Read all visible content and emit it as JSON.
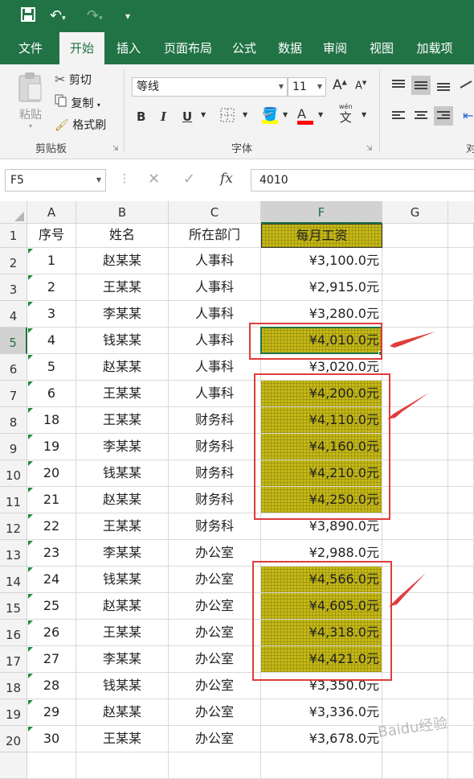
{
  "qat": {
    "save_icon": "floppy-disk-icon",
    "undo_icon": "undo-icon",
    "redo_icon": "redo-icon",
    "customize_icon": "customize-qat-icon"
  },
  "tabs": [
    "文件",
    "开始",
    "插入",
    "页面布局",
    "公式",
    "数据",
    "审阅",
    "视图",
    "加载项"
  ],
  "active_tab": "开始",
  "ribbon": {
    "clipboard": {
      "paste": "粘贴",
      "cut": "剪切",
      "copy": "复制",
      "format_painter": "格式刷",
      "label": "剪贴板"
    },
    "font": {
      "font_name": "等线",
      "font_size": "11",
      "grow": "A",
      "shrink": "A",
      "bold": "B",
      "italic": "I",
      "underline": "U",
      "font_color_letter": "A",
      "phonetic": "文",
      "phonetic_top": "wén",
      "label": "字体",
      "fill_color": "#ffff00",
      "font_color": "#ff0000"
    },
    "alignment_partial": "对"
  },
  "formula_bar": {
    "name_box": "F5",
    "cancel": "✕",
    "enter": "✓",
    "fx": "fx",
    "value": "4010"
  },
  "columns": [
    "A",
    "B",
    "C",
    "F",
    "G"
  ],
  "selected_column": "F",
  "header_row": [
    "序号",
    "姓名",
    "所在部门",
    "每月工资"
  ],
  "rows": [
    {
      "r": "2",
      "no": "1",
      "name": "赵某某",
      "dept": "人事科",
      "salary": "¥3,100.0元",
      "hl": false
    },
    {
      "r": "3",
      "no": "2",
      "name": "王某某",
      "dept": "人事科",
      "salary": "¥2,915.0元",
      "hl": false
    },
    {
      "r": "4",
      "no": "3",
      "name": "李某某",
      "dept": "人事科",
      "salary": "¥3,280.0元",
      "hl": false
    },
    {
      "r": "5",
      "no": "4",
      "name": "钱某某",
      "dept": "人事科",
      "salary": "¥4,010.0元",
      "hl": true
    },
    {
      "r": "6",
      "no": "5",
      "name": "赵某某",
      "dept": "人事科",
      "salary": "¥3,020.0元",
      "hl": false
    },
    {
      "r": "7",
      "no": "6",
      "name": "王某某",
      "dept": "人事科",
      "salary": "¥4,200.0元",
      "hl": true
    },
    {
      "r": "8",
      "no": "18",
      "name": "王某某",
      "dept": "财务科",
      "salary": "¥4,110.0元",
      "hl": true
    },
    {
      "r": "9",
      "no": "19",
      "name": "李某某",
      "dept": "财务科",
      "salary": "¥4,160.0元",
      "hl": true
    },
    {
      "r": "10",
      "no": "20",
      "name": "钱某某",
      "dept": "财务科",
      "salary": "¥4,210.0元",
      "hl": true
    },
    {
      "r": "11",
      "no": "21",
      "name": "赵某某",
      "dept": "财务科",
      "salary": "¥4,250.0元",
      "hl": true
    },
    {
      "r": "12",
      "no": "22",
      "name": "王某某",
      "dept": "财务科",
      "salary": "¥3,890.0元",
      "hl": false
    },
    {
      "r": "13",
      "no": "23",
      "name": "李某某",
      "dept": "办公室",
      "salary": "¥2,988.0元",
      "hl": false
    },
    {
      "r": "14",
      "no": "24",
      "name": "钱某某",
      "dept": "办公室",
      "salary": "¥4,566.0元",
      "hl": true
    },
    {
      "r": "15",
      "no": "25",
      "name": "赵某某",
      "dept": "办公室",
      "salary": "¥4,605.0元",
      "hl": true
    },
    {
      "r": "16",
      "no": "26",
      "name": "王某某",
      "dept": "办公室",
      "salary": "¥4,318.0元",
      "hl": true
    },
    {
      "r": "17",
      "no": "27",
      "name": "李某某",
      "dept": "办公室",
      "salary": "¥4,421.0元",
      "hl": true
    },
    {
      "r": "18",
      "no": "28",
      "name": "钱某某",
      "dept": "办公室",
      "salary": "¥3,350.0元",
      "hl": false
    },
    {
      "r": "19",
      "no": "29",
      "name": "赵某某",
      "dept": "办公室",
      "salary": "¥3,336.0元",
      "hl": false
    },
    {
      "r": "20",
      "no": "30",
      "name": "王某某",
      "dept": "办公室",
      "salary": "¥3,678.0元",
      "hl": false
    }
  ],
  "highlight_color": "#c5b918",
  "annotation_color": "#e03c3c",
  "watermark": "Baidu经验"
}
